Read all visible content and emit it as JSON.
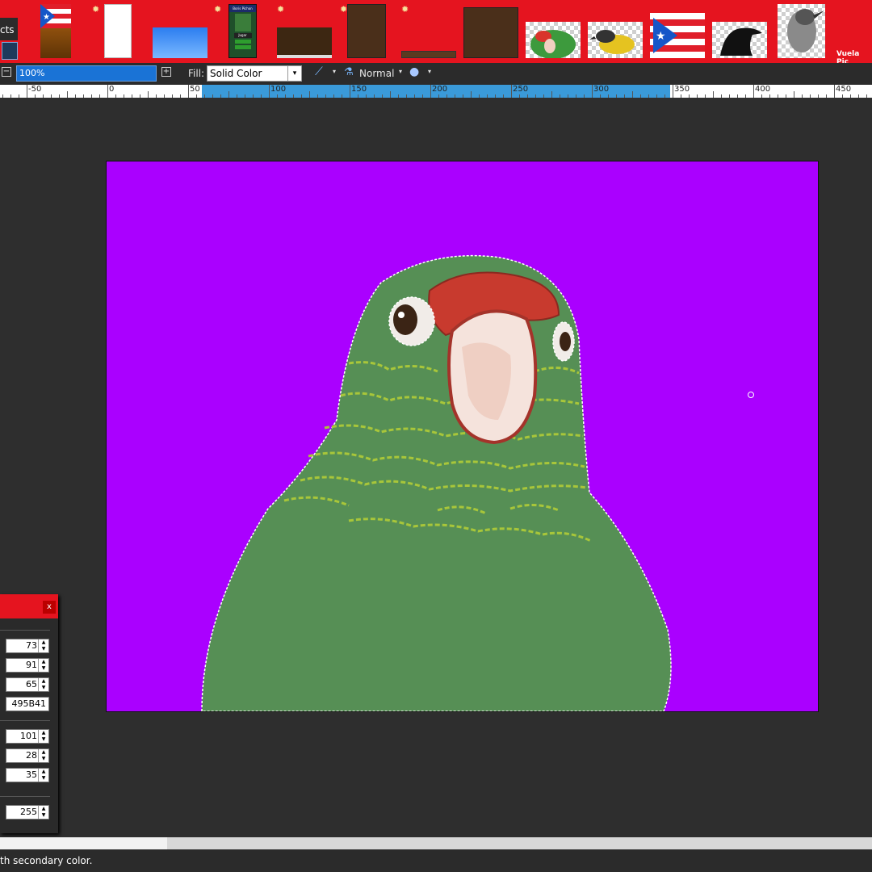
{
  "tab": {
    "label": "cts"
  },
  "thumbnails_label": "Vuela Pic",
  "thumbnail_caption": "Boris Pichon",
  "thumbnail_button": "Jugar",
  "toolbar": {
    "zoom_value": "100%",
    "fill_label": "Fill:",
    "fill_value": "Solid Color",
    "blend_mode": "Normal"
  },
  "ruler": {
    "labels": [
      "-50",
      "0",
      "50",
      "100",
      "150",
      "200",
      "250",
      "300",
      "350",
      "400",
      "450"
    ]
  },
  "color_panel": {
    "primary": {
      "r": "73",
      "g": "91",
      "b": "65",
      "hex": "495B41"
    },
    "secondary": {
      "h": "101",
      "s": "28",
      "v": "35"
    },
    "alpha": "255",
    "close_label": "x"
  },
  "status_text": "th secondary color.",
  "colors": {
    "canvas_bg": "#aa00ff",
    "parrot_green": "#558f55",
    "accent_red": "#e5141f",
    "highlight_blue": "#1a73d6"
  }
}
